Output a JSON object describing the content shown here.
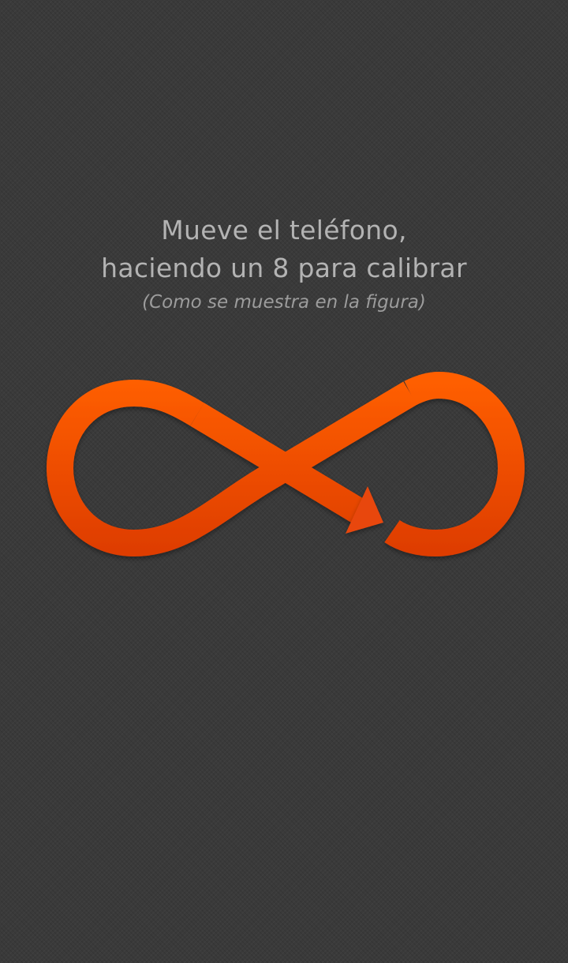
{
  "instructions": {
    "line1": "Mueve el teléfono,",
    "line2": "haciendo un 8 para calibrar",
    "sub": "(Como se muestra en la figura)"
  },
  "figure": {
    "icon": "infinity-arrow-icon",
    "colors": {
      "stroke_top": "#ff5f00",
      "stroke_bottom": "#dd3c00",
      "arrowhead": "#e8470a"
    }
  },
  "colors": {
    "background": "#3a3a3a",
    "text_primary": "#b3b3b3",
    "text_secondary": "#9c9c9c"
  }
}
